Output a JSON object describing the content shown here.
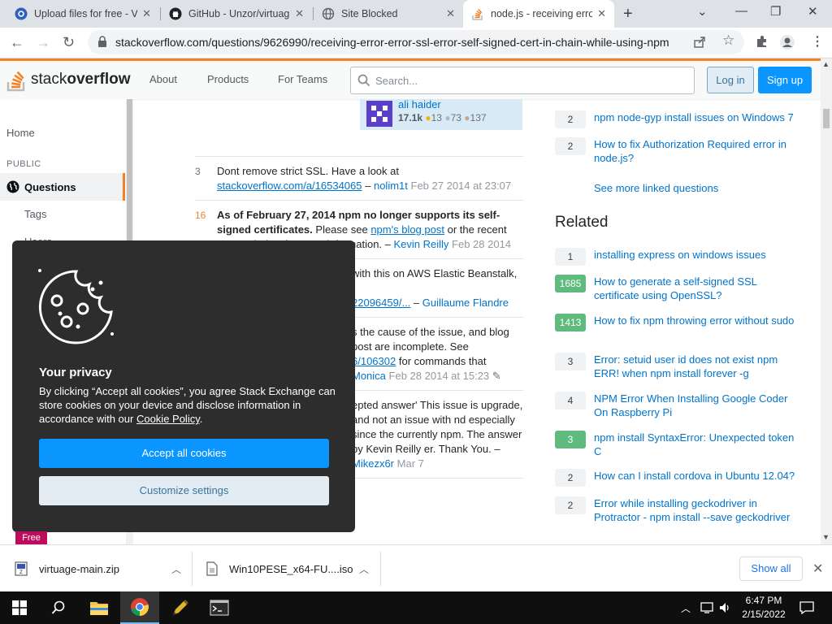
{
  "browser": {
    "tabs": [
      {
        "title": "Upload files for free - V"
      },
      {
        "title": "GitHub - Unzor/virtuag"
      },
      {
        "title": "Site Blocked"
      },
      {
        "title": "node.js - receiving erro"
      }
    ],
    "url": "stackoverflow.com/questions/9626990/receiving-error-error-ssl-error-self-signed-cert-in-chain-while-using-npm"
  },
  "header": {
    "logo_text_light": "stack",
    "logo_text_bold": "overflow",
    "nav": [
      "About",
      "Products",
      "For Teams"
    ],
    "search_placeholder": "Search...",
    "login": "Log in",
    "signup": "Sign up"
  },
  "leftnav": {
    "home": "Home",
    "public": "PUBLIC",
    "questions": "Questions",
    "tags": "Tags",
    "users": "Users"
  },
  "usercard": {
    "name": "ali haider",
    "rep": "17.1k",
    "gold": "13",
    "silver": "73",
    "bronze": "137"
  },
  "comments": [
    {
      "score": "3",
      "text": "Dont remove strict SSL. Have a look at ",
      "link": "stackoverflow.com/a/16534065",
      "author": "nolim1t",
      "date": "Feb 27 2014 at 23:07"
    },
    {
      "score": "16",
      "bold": "As of February 27, 2014 npm no longer supports its self-signed certificates.",
      "text": " Please see ",
      "link": "npm's blog post",
      "text2": " or the recent answer below for more information. – ",
      "author": "Kevin Reilly",
      "date": "Feb 28 2014"
    },
    {
      "text": "with this on AWS Elastic Beanstalk,",
      "link": "22096459/...",
      "author": "Guillaume Flandre"
    },
    {
      "text": "s the cause of the issue, and blog post are incomplete. See",
      "link": "6/106302",
      "text2": " for commands that",
      "author": "Monica",
      "date": "Feb 28 2014 at 15:23"
    },
    {
      "text": "epted answer' This issue is upgrade, and not an issue with nd especially since the currently npm. The answer by Kevin Reilly er. Thank You. – ",
      "author": "Mikezx6r",
      "date": "Mar 7"
    }
  ],
  "linked": [
    {
      "score": "2",
      "title": "npm node-gyp install issues on Windows 7"
    },
    {
      "score": "2",
      "title": "How to fix Authorization Required error in node.js?"
    }
  ],
  "see_more": "See more linked questions",
  "related_heading": "Related",
  "related": [
    {
      "score": "1",
      "accepted": false,
      "title": "installing express on windows issues"
    },
    {
      "score": "1685",
      "accepted": true,
      "title": "How to generate a self-signed SSL certificate using OpenSSL?"
    },
    {
      "score": "1413",
      "accepted": true,
      "title": "How to fix npm throwing error without sudo"
    },
    {
      "score": "3",
      "accepted": false,
      "title": "Error: setuid user id does not exist npm ERR! when npm install forever -g"
    },
    {
      "score": "4",
      "accepted": false,
      "title": "NPM Error When Installing Google Coder On Raspberry Pi"
    },
    {
      "score": "3",
      "accepted": true,
      "title": "npm install SyntaxError: Unexpected token C"
    },
    {
      "score": "2",
      "accepted": false,
      "title": "How can I install cordova in Ubuntu 12.04?"
    },
    {
      "score": "2",
      "accepted": false,
      "title": "Error while installing geckodriver in Protractor - npm install --save geckodriver"
    }
  ],
  "cookie": {
    "title": "Your privacy",
    "text": "By clicking “Accept all cookies”, you agree Stack Exchange can store cookies on your device and disclose information in accordance with our ",
    "policy_link": "Cookie Policy",
    "accept": "Accept all cookies",
    "customize": "Customize settings"
  },
  "free_badge": "Free",
  "downloads": [
    {
      "name": "virtuage-main.zip"
    },
    {
      "name": "Win10PESE_x64-FU....iso"
    }
  ],
  "show_all": "Show all",
  "clock": {
    "time": "6:47 PM",
    "date": "2/15/2022"
  },
  "colors": {
    "accent": "#f48225",
    "link": "#0074cc",
    "primary_button": "#0a95ff",
    "accepted_green": "#5eba7d"
  }
}
